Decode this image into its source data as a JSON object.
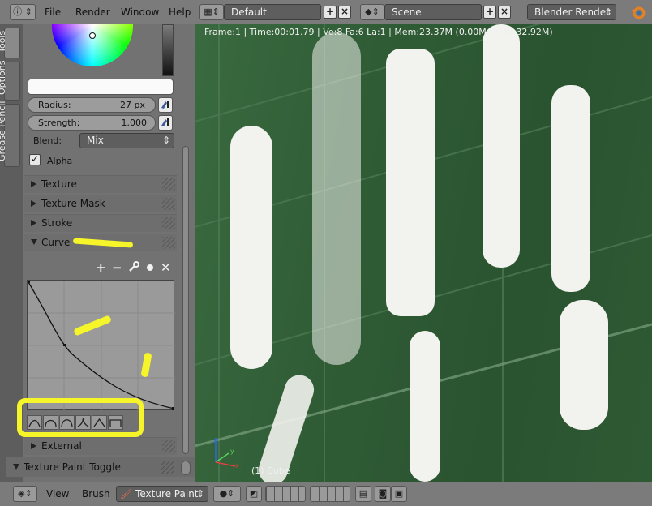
{
  "topbar": {
    "info_icon": "info-icon",
    "menus": [
      "File",
      "Render",
      "Window",
      "Help"
    ],
    "screen_layout": "Default",
    "scene": "Scene",
    "render_engine": "Blender Render"
  },
  "tabs": [
    "Tools",
    "Options",
    "Grease Pencil"
  ],
  "brush": {
    "radius_label": "Radius:",
    "radius_value": "27 px",
    "strength_label": "Strength:",
    "strength_value": "1.000",
    "blend_label": "Blend:",
    "blend_value": "Mix",
    "alpha_label": "Alpha",
    "alpha_checked": true
  },
  "sections": {
    "texture": "Texture",
    "texture_mask": "Texture Mask",
    "stroke": "Stroke",
    "curve": "Curve",
    "external": "External",
    "texture_paint_toggle": "Texture Paint Toggle"
  },
  "curve_tools": [
    "+",
    "−",
    "wrench-icon",
    "dot-icon",
    "x-icon"
  ],
  "curve_presets": [
    "smooth",
    "round",
    "root",
    "sharp",
    "line",
    "max"
  ],
  "viewport": {
    "info": "Frame:1 | Time:00:01.79 | Ve:8 Fa:6 La:1 | Mem:23.37M (0.00M, Peak 32.92M)",
    "object_label": "(1) Cube"
  },
  "bottombar": {
    "view": "View",
    "brush": "Brush",
    "mode": "Texture Paint"
  },
  "colors": {
    "highlight": "#f5f52a",
    "viewport_bg": "#2d5a33",
    "panel_bg": "#727272"
  }
}
